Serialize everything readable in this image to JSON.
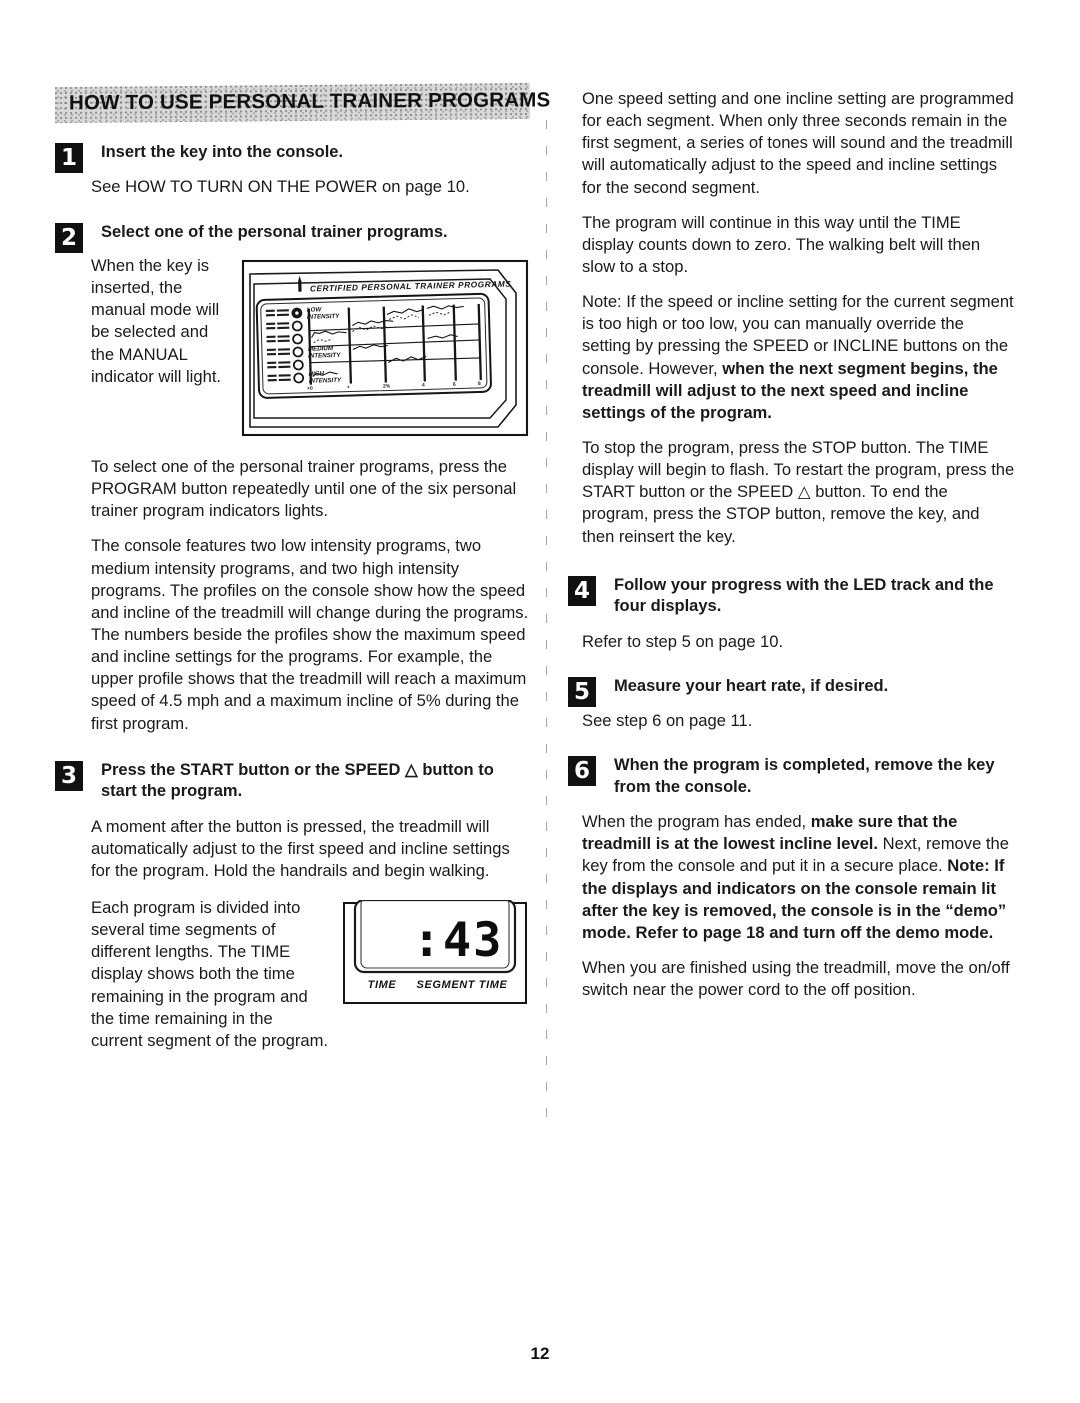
{
  "document": {
    "page_number": "12",
    "section_heading": "HOW TO USE PERSONAL TRAINER PROGRAMS"
  },
  "left_column": {
    "step1": {
      "number": "1",
      "title": "Insert the key into the console.",
      "body": "See HOW TO TURN ON THE POWER on page 10."
    },
    "step2": {
      "number": "2",
      "title": "Select one of the personal trainer programs.",
      "wrap_text": "When the key is inserted, the manual mode will be selected and the MANUAL indicator will light.",
      "para1": "To select one of the personal trainer programs, press the PROGRAM button repeatedly until one of the six personal trainer program indicators lights.",
      "para2": "The console features two low intensity programs, two medium intensity programs, and two high intensity programs. The profiles on the console show how the speed and incline of the treadmill will change during the programs. The numbers beside the profiles show the maximum speed and incline settings for the programs. For example, the upper profile shows that the treadmill will reach a maximum speed of 4.5 mph and a maximum incline of 5% during the first program."
    },
    "step3": {
      "number": "3",
      "title": "Press the START button or the SPEED △ button to start the program.",
      "para1": "A moment after the button is pressed, the treadmill will automatically adjust to the first speed and incline settings for the program. Hold the handrails and begin walking.",
      "wrap_text": "Each program is divided into several time segments of different lengths. The TIME display shows both the time remaining in the program and the time remaining in the current segment of the program."
    }
  },
  "right_column": {
    "para1": "One speed setting and one incline setting are programmed for each segment. When only three seconds remain in the first segment, a series of tones will sound and the treadmill will automatically adjust to the speed and incline settings for the second segment.",
    "para2": "The program will continue in this way until the TIME display counts down to zero. The walking belt will then slow to a stop.",
    "note_plain_start": "Note: If the speed or incline setting for the current segment is too high or too low, you can manually override the setting by pressing the SPEED or INCLINE buttons on the console. However, ",
    "note_bold_end": "when the next segment begins, the treadmill will adjust to the next speed and incline settings of the program.",
    "para4": "To stop the program, press the STOP button. The TIME display will begin to flash. To restart the program, press the START button or the SPEED △ button. To end the program, press the STOP button, remove the key, and then reinsert the key.",
    "step4": {
      "number": "4",
      "title": "Follow your progress with the LED track and the four displays.",
      "body": "Refer to step 5 on page 10."
    },
    "step5": {
      "number": "5",
      "title": "Measure your heart rate, if desired.",
      "body": "See step 6 on page 11."
    },
    "step6": {
      "number": "6",
      "title": "When the program is completed, remove the key from the console.",
      "final_seg1": "When the program has ended, ",
      "final_seg2_bold": "make sure that the treadmill is at the lowest incline level.",
      "final_seg3": " Next, remove the key from the console and put it in a secure place. ",
      "final_seg4_bold": "Note: If the displays and indicators on the console remain lit after the key is removed, the console is in the “demo” mode. Refer to page 18 and turn off the demo mode.",
      "closing": "When you are finished using the treadmill, move the on/off switch near the power cord to the off position."
    }
  },
  "figures": {
    "console": {
      "header_label": "CERTIFIED PERSONAL TRAINER PROGRAMS",
      "intensity_labels": [
        "LOW INTENSITY",
        "MEDIUM INTENSITY",
        "HIGH INTENSITY"
      ],
      "indicator_count": 6
    },
    "led_display": {
      "value": ":43",
      "label_left": "TIME",
      "label_right": "SEGMENT TIME"
    }
  }
}
